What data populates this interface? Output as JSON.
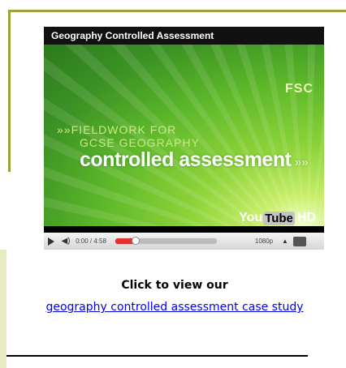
{
  "player": {
    "title": "Geography Controlled Assessment",
    "video": {
      "brand": "FSC",
      "line1": "»»FIELDWORK FOR",
      "line2": "GCSE GEOGRAPHY",
      "line3": "controlled assessment",
      "line3_tail": "»»"
    },
    "logo": {
      "you": "You",
      "tube": "Tube",
      "hd": "HD"
    },
    "controls": {
      "time": "0:00 / 4:58",
      "quality": "1080p",
      "progress_fraction": 0.2
    }
  },
  "caption": "Click to view our",
  "link_text": "geography controlled assessment case study",
  "colors": {
    "frame": "#9da13c",
    "link": "#0000ee",
    "accent": "#d33333"
  }
}
